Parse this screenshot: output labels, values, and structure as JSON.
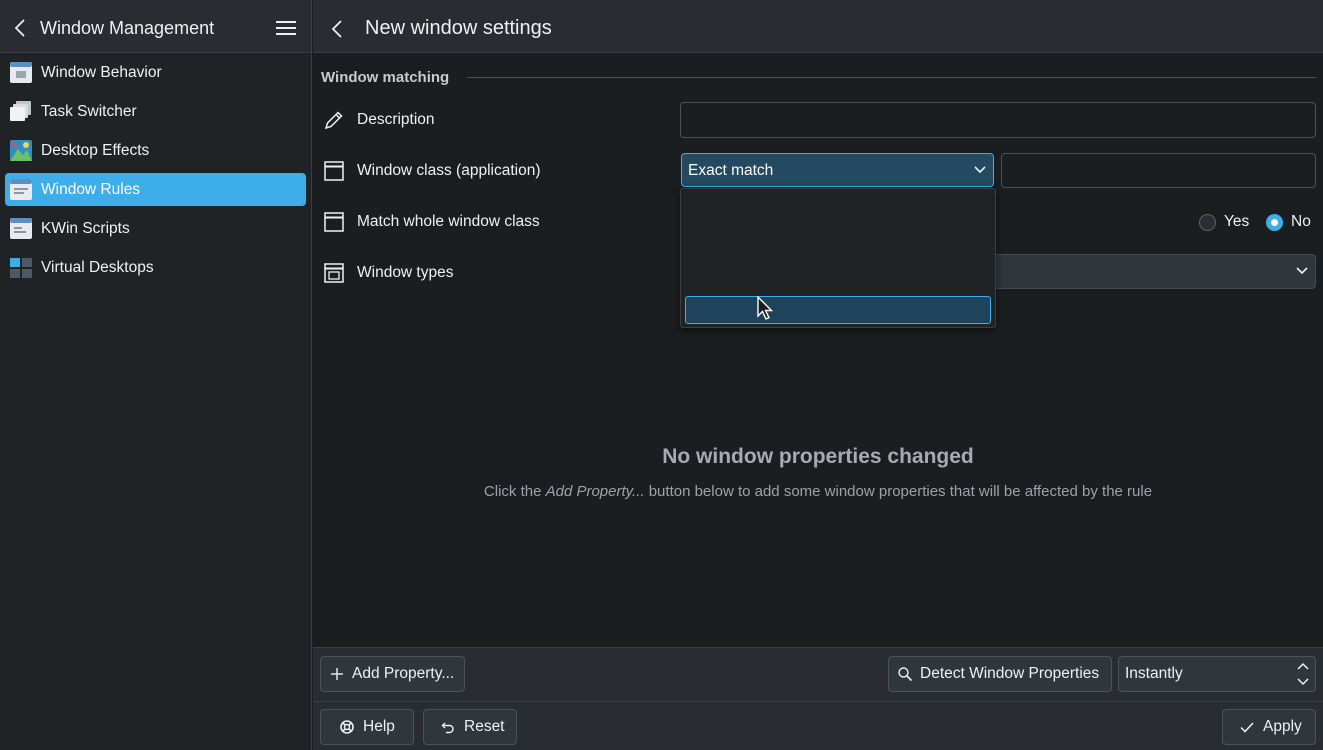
{
  "sidebar": {
    "title": "Window Management",
    "items": [
      {
        "label": "Window Behavior",
        "icon": "window-behavior-icon"
      },
      {
        "label": "Task Switcher",
        "icon": "task-switcher-icon"
      },
      {
        "label": "Desktop Effects",
        "icon": "desktop-effects-icon"
      },
      {
        "label": "Window Rules",
        "icon": "window-rules-icon",
        "active": true
      },
      {
        "label": "KWin Scripts",
        "icon": "kwin-scripts-icon"
      },
      {
        "label": "Virtual Desktops",
        "icon": "virtual-desktops-icon"
      }
    ]
  },
  "header": {
    "title": "New window settings"
  },
  "matching": {
    "section_title": "Window matching",
    "rows": {
      "description": {
        "label": "Description",
        "value": ""
      },
      "window_class": {
        "label": "Window class (application)",
        "match_value": "Exact match",
        "text_value": ""
      },
      "whole_class": {
        "label": "Match whole window class",
        "yes": "Yes",
        "no": "No",
        "selected": "No"
      },
      "window_types": {
        "label": "Window types"
      }
    }
  },
  "empty_state": {
    "title": "No window properties changed",
    "text_before": "Click the ",
    "text_em": "Add Property...",
    "text_after": " button below to add some window properties that will be affected by the rule"
  },
  "footer": {
    "add_property": "Add Property...",
    "detect": "Detect Window Properties",
    "detect_delay": "Instantly",
    "help": "Help",
    "reset": "Reset",
    "apply": "Apply"
  },
  "colors": {
    "accent": "#3daee9",
    "background": "#1b1e20",
    "surface": "#292c30"
  }
}
